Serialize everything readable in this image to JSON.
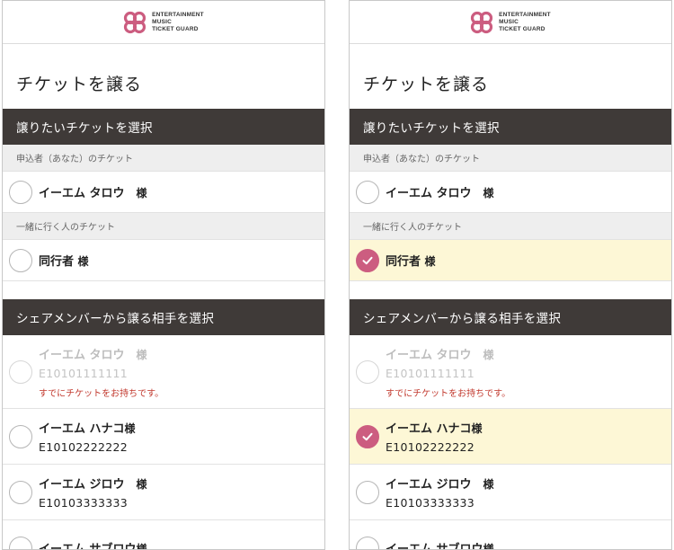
{
  "brand": {
    "line1": "ENTERTAINMENT",
    "line2": "MUSIC",
    "line3": "TICKET GUARD",
    "color": "#cc5d80"
  },
  "page_title": "チケットを譲る",
  "section_select_ticket": "譲りたいチケットを選択",
  "applicant_header": "申込者（あなた）のチケット",
  "applicant": {
    "name": "イーエム タロウ　",
    "sama": "様"
  },
  "companion_header": "一緒に行く人のチケット",
  "companion": {
    "name": "同行者 ",
    "sama": "様"
  },
  "section_select_member": "シェアメンバーから譲る相手を選択",
  "members": [
    {
      "name": "イーエム タロウ　",
      "sama": "様",
      "id": "E10101111111",
      "notice": "すでにチケットをお持ちです。"
    },
    {
      "name": "イーエム ハナコ",
      "sama": "様",
      "id": "E10102222222"
    },
    {
      "name": "イーエム ジロウ　",
      "sama": "様",
      "id": "E10103333333"
    },
    {
      "name": "イーエム サブロウ",
      "sama": "様"
    }
  ],
  "colors": {
    "section_bg": "#3f3a38",
    "selected_bg": "#fdf7d6",
    "check_fill": "#cc5d80",
    "notice_text": "#c23a2f"
  }
}
